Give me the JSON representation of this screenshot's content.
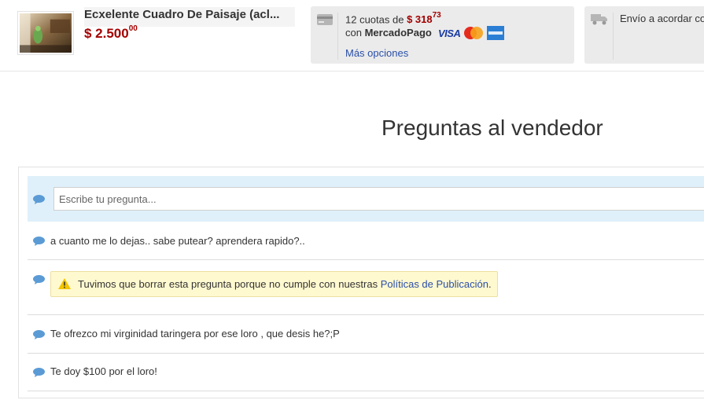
{
  "product": {
    "title": "Ecxelente Cuadro De Paisaje (acl...",
    "price_main": "$ 2.500",
    "price_cents": "00"
  },
  "payment": {
    "cuotas_prefix": "12 cuotas de ",
    "cuota_price_main": "$ 318",
    "cuota_price_cents": "73",
    "con_label": "con ",
    "provider": "MercadoPago",
    "brands": [
      "VISA",
      "MasterCard",
      "AMERICAN EXPRESS"
    ],
    "more_options": "Más opciones",
    "icon": "credit-card-icon"
  },
  "shipping": {
    "text": "Envío a acordar con",
    "icon": "truck-icon"
  },
  "questions": {
    "title": "Preguntas al vendedor",
    "input_placeholder": "Escribe tu pregunta...",
    "items": [
      {
        "text": "a cuanto me lo dejas.. sabe putear? aprendera rapido?.."
      },
      {
        "notice_text": "Tuvimos que borrar esta pregunta porque no cumple con nuestras ",
        "notice_link": "Políticas de Publicación",
        "notice_end": "."
      },
      {
        "text": "Te ofrezco mi virginidad taringera por ese loro , que desis he?;P"
      },
      {
        "text": "Te doy $100 por el loro!"
      }
    ]
  },
  "colors": {
    "price_red": "#a30000",
    "link_blue": "#2a4fa8",
    "ask_row_bg": "#dff0fa",
    "bubble_blue": "#5b9bd5",
    "notice_bg": "#fff9d0"
  }
}
